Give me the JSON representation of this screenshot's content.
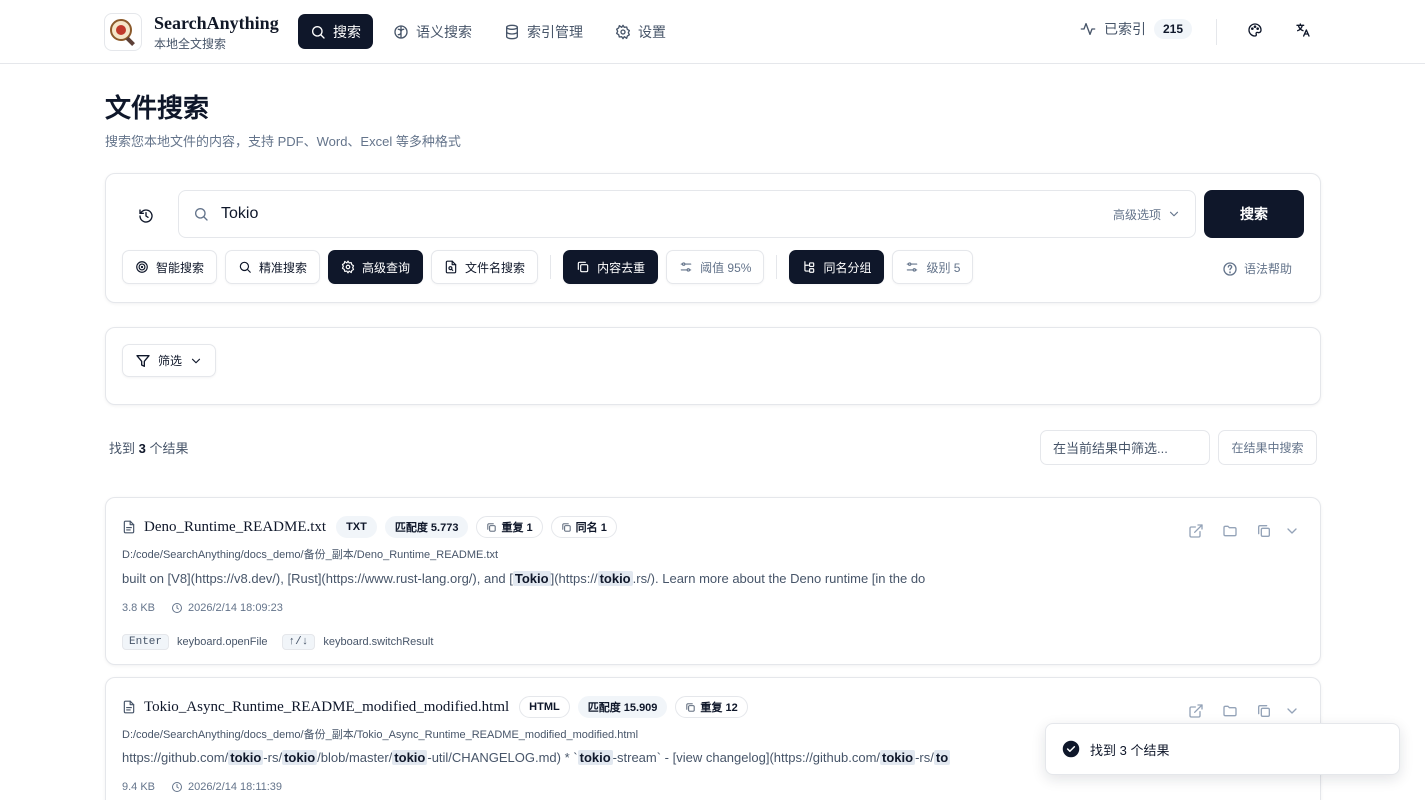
{
  "brand": {
    "title": "SearchAnything",
    "subtitle": "本地全文搜索"
  },
  "nav": [
    {
      "label": "搜索",
      "icon": "search-icon",
      "active": true
    },
    {
      "label": "语义搜索",
      "icon": "brain-icon"
    },
    {
      "label": "索引管理",
      "icon": "database-icon"
    },
    {
      "label": "设置",
      "icon": "gear-icon"
    }
  ],
  "header": {
    "indexed_label": "已索引",
    "indexed_count": "215"
  },
  "page": {
    "title": "文件搜索",
    "subtitle": "搜索您本地文件的内容，支持 PDF、Word、Excel 等多种格式"
  },
  "search": {
    "value": "Tokio",
    "advanced_label": "高级选项",
    "button": "搜索"
  },
  "modes": {
    "smart": "智能搜索",
    "exact": "精准搜索",
    "advanced": "高级查询",
    "filename": "文件名搜索",
    "dedupe": "内容去重",
    "threshold": "阈值 95%",
    "group": "同名分组",
    "level": "级别 5",
    "help": "语法帮助"
  },
  "filter": {
    "label": "筛选"
  },
  "results": {
    "count_prefix": "找到",
    "count": "3",
    "count_suffix": "个结果",
    "filter_placeholder": "在当前结果中筛选...",
    "filter_button": "在结果中搜索",
    "items": [
      {
        "name": "Deno_Runtime_README.txt",
        "type": "TXT",
        "score": "匹配度 5.773",
        "dup": "重复 1",
        "same": "同名 1",
        "path": "D:/code/SearchAnything/docs_demo/备份_副本/Deno_Runtime_README.txt",
        "snippet": [
          "built on [V8](https://v8.dev/), [Rust](https://www.rust-lang.org/), and [",
          "Tokio",
          "](https://",
          "tokio",
          ".rs/). Learn more about the Deno runtime [in the do"
        ],
        "size": "3.8 KB",
        "time": "2026/2/14 18:09:23",
        "key1": "Enter",
        "key1_label": "keyboard.openFile",
        "key2": "↑/↓",
        "key2_label": "keyboard.switchResult"
      },
      {
        "name": "Tokio_Async_Runtime_README_modified_modified.html",
        "type": "HTML",
        "score": "匹配度 15.909",
        "dup": "重复 12",
        "path": "D:/code/SearchAnything/docs_demo/备份_副本/Tokio_Async_Runtime_README_modified_modified.html",
        "snippet": [
          "https://github.com/",
          "tokio",
          "-rs/",
          "tokio",
          "/blob/master/",
          "tokio",
          "-util/CHANGELOG.md) * `",
          "tokio",
          "-stream` - [view changelog](https://github.com/",
          "tokio",
          "-rs/",
          "to"
        ],
        "size": "9.4 KB",
        "time": "2026/2/14 18:11:39"
      }
    ]
  },
  "toast": {
    "message": "找到 3 个结果"
  }
}
